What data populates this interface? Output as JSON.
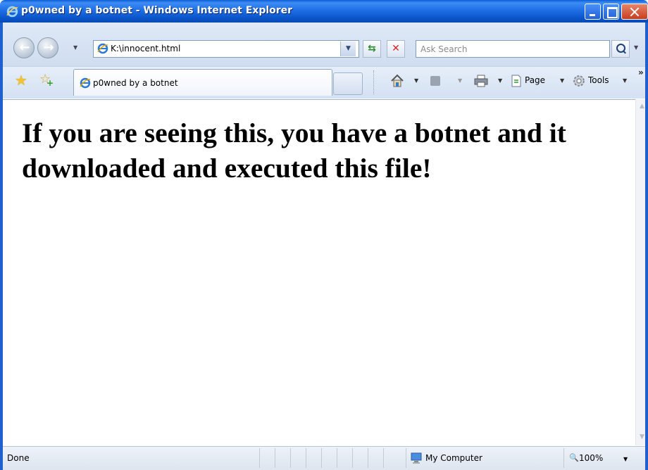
{
  "window": {
    "title": "p0wned by a botnet - Windows Internet Explorer"
  },
  "navbar": {
    "address": "K:\\innocent.html",
    "search_placeholder": "Ask Search"
  },
  "tabs": [
    {
      "label": "p0wned by a botnet"
    }
  ],
  "commandbar": {
    "page_label": "Page",
    "tools_label": "Tools"
  },
  "content": {
    "heading": "If you are seeing this, you have a botnet and it downloaded and executed this file!"
  },
  "statusbar": {
    "status": "Done",
    "zone": "My Computer",
    "zoom": "100%"
  },
  "colors": {
    "titlebar": "#1f6fe6",
    "frame": "#1f5fd0",
    "stop": "#d42323",
    "refresh": "#2e8a2e"
  },
  "icons": [
    "ie-icon",
    "back-arrow-icon",
    "forward-arrow-icon",
    "refresh-icon",
    "stop-icon",
    "search-icon",
    "favorites-star-icon",
    "add-favorites-icon",
    "home-icon",
    "feeds-icon",
    "print-icon",
    "page-icon",
    "tools-gear-icon",
    "computer-zone-icon",
    "zoom-icon"
  ]
}
